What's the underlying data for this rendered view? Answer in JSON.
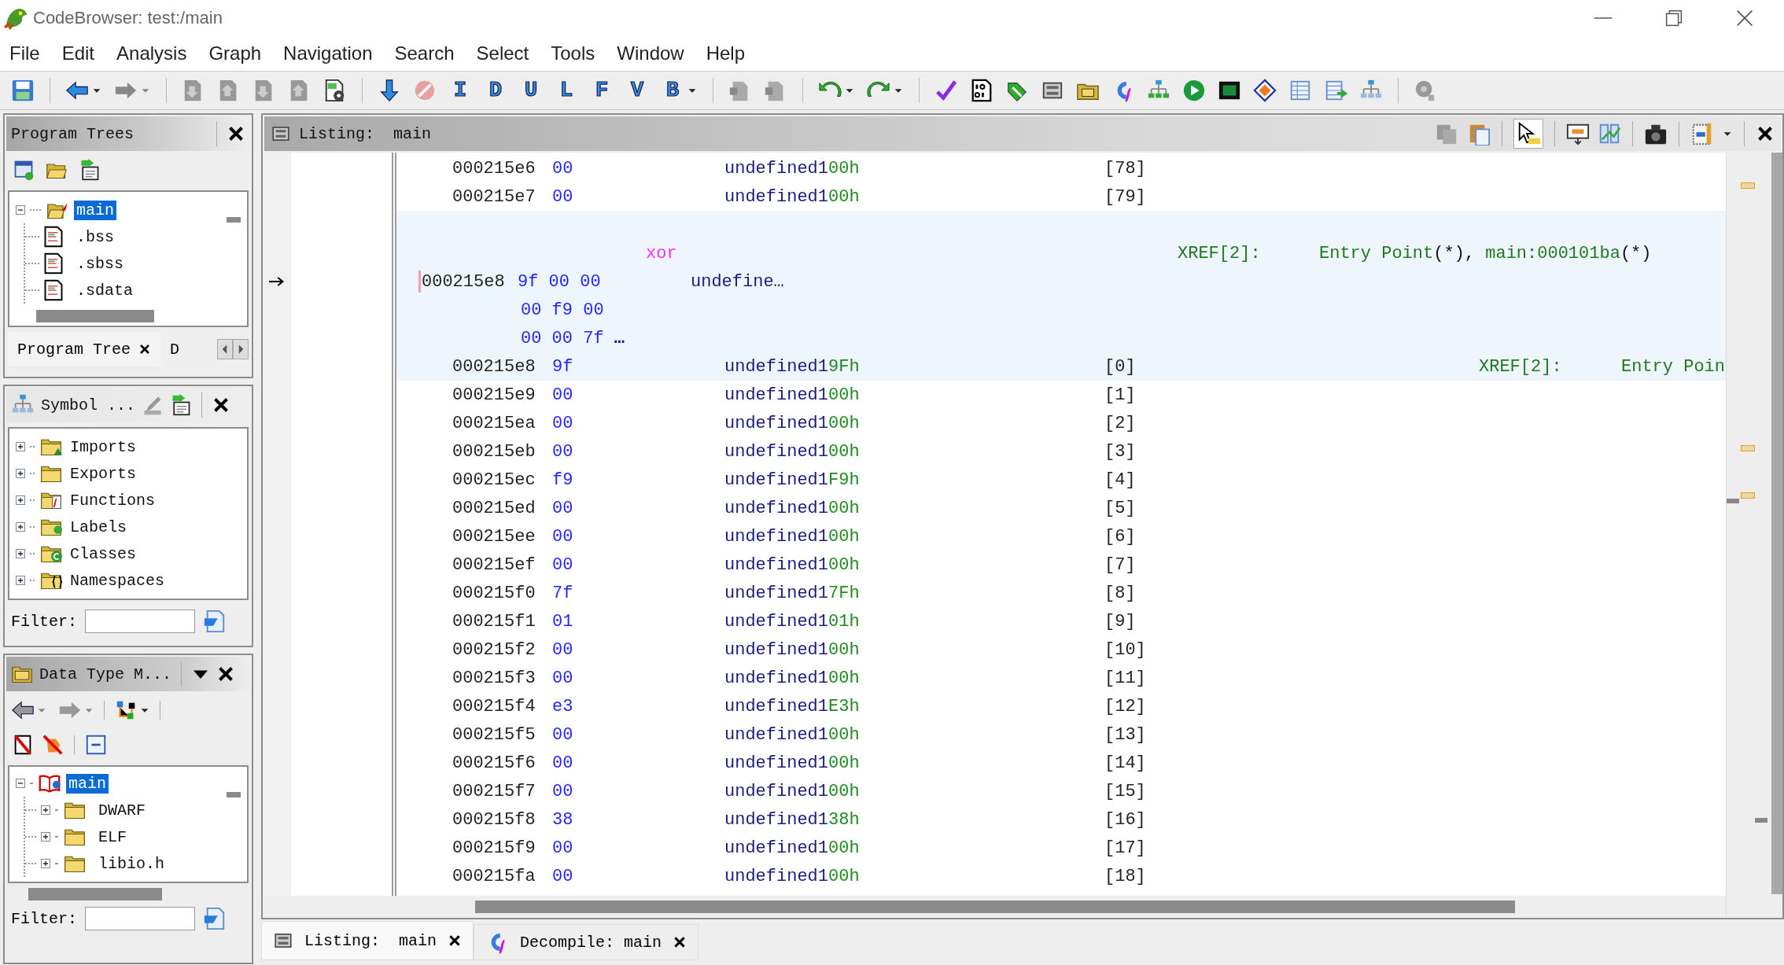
{
  "window": {
    "title": "CodeBrowser: test:/main"
  },
  "menu": [
    "File",
    "Edit",
    "Analysis",
    "Graph",
    "Navigation",
    "Search",
    "Select",
    "Tools",
    "Window",
    "Help"
  ],
  "toolbar": {
    "letters": [
      "I",
      "D",
      "U",
      "L",
      "F",
      "V",
      "B"
    ]
  },
  "program_trees": {
    "title": "Program Trees",
    "tree": [
      {
        "label": "main",
        "selected": true,
        "expanded": true,
        "children": [
          {
            "label": ".bss",
            "selected": false
          },
          {
            "label": ".sbss",
            "selected": false
          },
          {
            "label": ".sdata",
            "selected": false
          }
        ]
      }
    ],
    "tabs": [
      {
        "label": "Program Tree",
        "selected": true
      },
      {
        "label": "D",
        "selected": false
      }
    ]
  },
  "symbol_tree": {
    "title": "Symbol ...",
    "items": [
      {
        "label": "Imports",
        "expanded": false
      },
      {
        "label": "Exports",
        "expanded": false
      },
      {
        "label": "Functions",
        "expanded": false
      },
      {
        "label": "Labels",
        "expanded": false
      },
      {
        "label": "Classes",
        "expanded": false
      },
      {
        "label": "Namespaces",
        "expanded": false
      }
    ],
    "filter": {
      "label": "Filter:"
    }
  },
  "data_type_manager": {
    "title": "Data Type M...",
    "tree": [
      {
        "label": "main",
        "selected": true,
        "expanded": true,
        "children": [
          {
            "label": "DWARF",
            "selected": false,
            "expanded": false
          },
          {
            "label": "ELF",
            "selected": false,
            "expanded": false
          },
          {
            "label": "libio.h",
            "selected": false,
            "expanded": false
          }
        ]
      }
    ],
    "filter": {
      "label": "Filter:"
    }
  },
  "listing": {
    "title": "Listing:  main",
    "entries": [
      {
        "kind": "data",
        "highlighted": false,
        "address": "000215e6",
        "bytes": "00",
        "mnemonic": "undefined1",
        "operand": "00h",
        "index": "[78]"
      },
      {
        "kind": "data",
        "highlighted": false,
        "address": "000215e7",
        "bytes": "00",
        "mnemonic": "undefined1",
        "operand": "00h",
        "index": "[79]"
      },
      {
        "kind": "label",
        "highlighted": true,
        "label": "xor",
        "xref_label": "XREF[2]:",
        "xrefs": [
          {
            "target": "Entry Point",
            "ref": "(*),"
          },
          {
            "target": "main:000101ba",
            "ref": "(*)"
          }
        ]
      },
      {
        "kind": "struct",
        "highlighted": true,
        "cursor": true,
        "address": "000215e8",
        "bytes": [
          "9f 00 00",
          "00 f9 00",
          "00 00 7f"
        ],
        "bytes_more": "…",
        "mnemonic": "undefine…"
      },
      {
        "kind": "data",
        "highlighted": true,
        "address": "000215e8",
        "bytes": "9f",
        "mnemonic": "undefined1",
        "operand": "9Fh",
        "index": "[0]",
        "xref_label": "XREF[2]:",
        "xrefs": [
          {
            "target": "Entry Poin"
          }
        ]
      },
      {
        "kind": "data",
        "highlighted": false,
        "address": "000215e9",
        "bytes": "00",
        "mnemonic": "undefined1",
        "operand": "00h",
        "index": "[1]"
      },
      {
        "kind": "data",
        "highlighted": false,
        "address": "000215ea",
        "bytes": "00",
        "mnemonic": "undefined1",
        "operand": "00h",
        "index": "[2]"
      },
      {
        "kind": "data",
        "highlighted": false,
        "address": "000215eb",
        "bytes": "00",
        "mnemonic": "undefined1",
        "operand": "00h",
        "index": "[3]"
      },
      {
        "kind": "data",
        "highlighted": false,
        "address": "000215ec",
        "bytes": "f9",
        "mnemonic": "undefined1",
        "operand": "F9h",
        "index": "[4]"
      },
      {
        "kind": "data",
        "highlighted": false,
        "address": "000215ed",
        "bytes": "00",
        "mnemonic": "undefined1",
        "operand": "00h",
        "index": "[5]"
      },
      {
        "kind": "data",
        "highlighted": false,
        "address": "000215ee",
        "bytes": "00",
        "mnemonic": "undefined1",
        "operand": "00h",
        "index": "[6]"
      },
      {
        "kind": "data",
        "highlighted": false,
        "address": "000215ef",
        "bytes": "00",
        "mnemonic": "undefined1",
        "operand": "00h",
        "index": "[7]"
      },
      {
        "kind": "data",
        "highlighted": false,
        "address": "000215f0",
        "bytes": "7f",
        "mnemonic": "undefined1",
        "operand": "7Fh",
        "index": "[8]"
      },
      {
        "kind": "data",
        "highlighted": false,
        "address": "000215f1",
        "bytes": "01",
        "mnemonic": "undefined1",
        "operand": "01h",
        "index": "[9]"
      },
      {
        "kind": "data",
        "highlighted": false,
        "address": "000215f2",
        "bytes": "00",
        "mnemonic": "undefined1",
        "operand": "00h",
        "index": "[10]"
      },
      {
        "kind": "data",
        "highlighted": false,
        "address": "000215f3",
        "bytes": "00",
        "mnemonic": "undefined1",
        "operand": "00h",
        "index": "[11]"
      },
      {
        "kind": "data",
        "highlighted": false,
        "address": "000215f4",
        "bytes": "e3",
        "mnemonic": "undefined1",
        "operand": "E3h",
        "index": "[12]"
      },
      {
        "kind": "data",
        "highlighted": false,
        "address": "000215f5",
        "bytes": "00",
        "mnemonic": "undefined1",
        "operand": "00h",
        "index": "[13]"
      },
      {
        "kind": "data",
        "highlighted": false,
        "address": "000215f6",
        "bytes": "00",
        "mnemonic": "undefined1",
        "operand": "00h",
        "index": "[14]"
      },
      {
        "kind": "data",
        "highlighted": false,
        "address": "000215f7",
        "bytes": "00",
        "mnemonic": "undefined1",
        "operand": "00h",
        "index": "[15]"
      },
      {
        "kind": "data",
        "highlighted": false,
        "address": "000215f8",
        "bytes": "38",
        "mnemonic": "undefined1",
        "operand": "38h",
        "index": "[16]"
      },
      {
        "kind": "data",
        "highlighted": false,
        "address": "000215f9",
        "bytes": "00",
        "mnemonic": "undefined1",
        "operand": "00h",
        "index": "[17]"
      },
      {
        "kind": "data",
        "highlighted": false,
        "address": "000215fa",
        "bytes": "00",
        "mnemonic": "undefined1",
        "operand": "00h",
        "index": "[18]"
      }
    ]
  },
  "bottom_tabs": [
    {
      "label": "Listing:  main",
      "selected": true
    },
    {
      "label": "Decompile: main",
      "selected": false
    }
  ]
}
